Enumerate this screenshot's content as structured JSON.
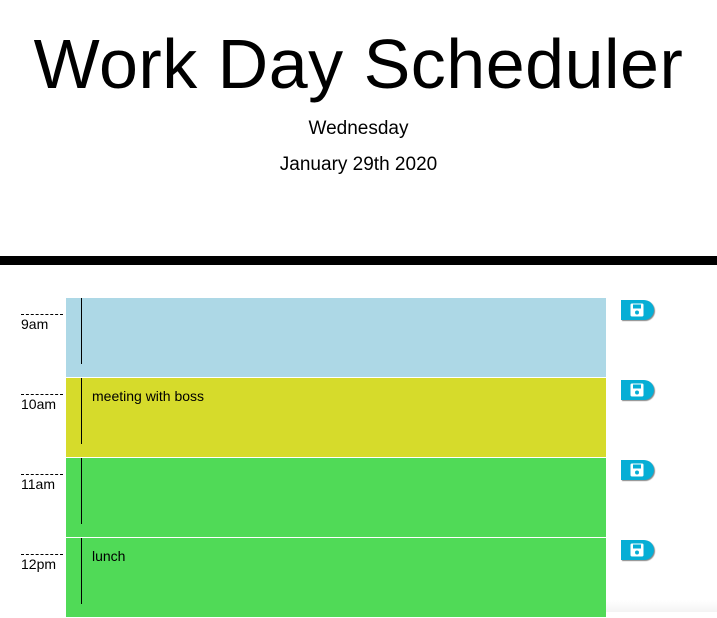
{
  "header": {
    "title": "Work Day Scheduler",
    "weekday": "Wednesday",
    "date": "January 29th 2020"
  },
  "schedule": {
    "rows": [
      {
        "hour": "9am",
        "state": "past",
        "note": ""
      },
      {
        "hour": "10am",
        "state": "present",
        "note": "meeting with boss"
      },
      {
        "hour": "11am",
        "state": "future",
        "note": ""
      },
      {
        "hour": "12pm",
        "state": "future",
        "note": "lunch"
      }
    ]
  },
  "colors": {
    "past": "#add8e6",
    "present": "#d6db2b",
    "future": "#50da57",
    "save_button": "#06aed5",
    "divider": "#000000"
  },
  "icons": {
    "save": "floppy-disk-icon"
  }
}
